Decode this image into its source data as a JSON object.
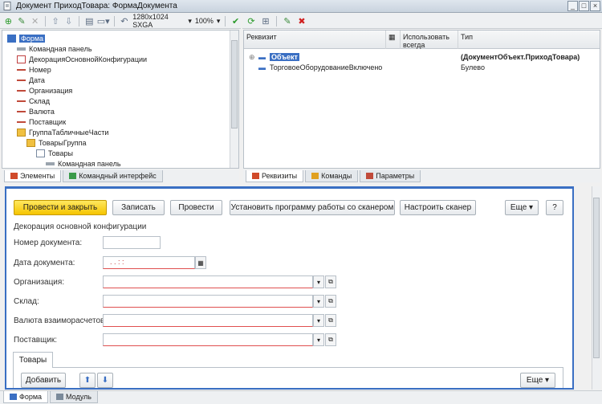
{
  "window": {
    "title": "Документ ПриходТовара: ФормаДокумента"
  },
  "toolbar_left": {
    "resolution": "1280x1024 SXGA",
    "zoom": "100%"
  },
  "tree": [
    {
      "label": "Форма",
      "icon": "form-icon",
      "level": 0,
      "selected": true
    },
    {
      "label": "Командная панель",
      "icon": "command-panel-icon",
      "level": 1
    },
    {
      "label": "ДекорацияОсновнойКонфигурации",
      "icon": "decoration-icon",
      "level": 1
    },
    {
      "label": "Номер",
      "icon": "field-icon",
      "level": 1
    },
    {
      "label": "Дата",
      "icon": "field-icon",
      "level": 1
    },
    {
      "label": "Организация",
      "icon": "field-icon",
      "level": 1
    },
    {
      "label": "Склад",
      "icon": "field-icon",
      "level": 1
    },
    {
      "label": "Валюта",
      "icon": "field-icon",
      "level": 1
    },
    {
      "label": "Поставщик",
      "icon": "field-icon",
      "level": 1
    },
    {
      "label": "ГруппаТабличныеЧасти",
      "icon": "folder-icon",
      "level": 1
    },
    {
      "label": "ТоварыГруппа",
      "icon": "folder-icon",
      "level": 2
    },
    {
      "label": "Товары",
      "icon": "table-icon",
      "level": 3
    },
    {
      "label": "Командная панель",
      "icon": "command-panel-icon",
      "level": 4
    }
  ],
  "left_tabs": [
    "Элементы",
    "Командный интерфейс"
  ],
  "right_tabs": [
    "Реквизиты",
    "Команды",
    "Параметры"
  ],
  "requisites": {
    "headers": {
      "name": "Реквизит",
      "always": "Использовать всегда",
      "type": "Тип"
    },
    "rows": [
      {
        "name": "Объект",
        "type": "(ДокументОбъект.ПриходТовара)",
        "selected": true
      },
      {
        "name": "ТорговоеОборудованиеВключено",
        "type": "Булево"
      }
    ]
  },
  "form": {
    "buttons": {
      "post_close": "Провести и закрыть",
      "save": "Записать",
      "post": "Провести",
      "install_scanner": "Установить программу работы со сканером",
      "setup_scanner": "Настроить сканер",
      "more": "Еще",
      "help": "?"
    },
    "decoration": "Декорация основной конфигурации",
    "fields": {
      "number": "Номер документа:",
      "date": "Дата документа:",
      "date_value": ". .   : :",
      "org": "Организация:",
      "warehouse": "Склад:",
      "currency": "Валюта взаиморасчетов:",
      "supplier": "Поставщик:"
    },
    "goods_tab": "Товары",
    "add": "Добавить",
    "more2": "Еще"
  },
  "footer_tabs": [
    "Форма",
    "Модуль"
  ]
}
